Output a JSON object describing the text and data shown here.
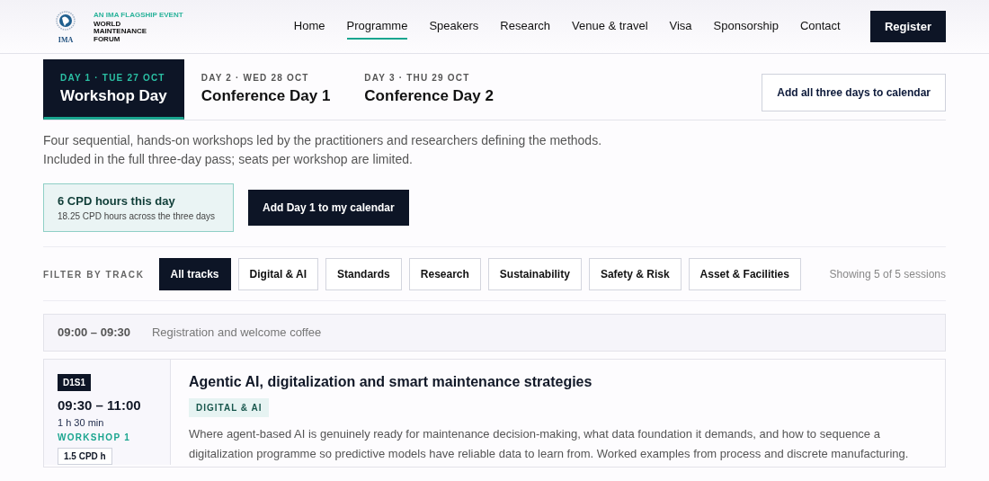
{
  "logo": {
    "tagline": "AN IMA FLAGSHIP EVENT",
    "emblem_text": "IMA",
    "name_lines": [
      "WORLD",
      "MAINTENANCE",
      "FORUM"
    ]
  },
  "nav": [
    {
      "label": "Home",
      "selected": false
    },
    {
      "label": "Programme",
      "selected": true
    },
    {
      "label": "Speakers",
      "selected": false
    },
    {
      "label": "Research",
      "selected": false
    },
    {
      "label": "Venue & travel",
      "selected": false
    },
    {
      "label": "Visa",
      "selected": false
    },
    {
      "label": "Sponsorship",
      "selected": false
    },
    {
      "label": "Contact",
      "selected": false
    }
  ],
  "register_button": "Register",
  "days": [
    {
      "date": "DAY 1 · TUE 27 OCT",
      "title": "Workshop Day",
      "selected": true
    },
    {
      "date": "DAY 2 · WED 28 OCT",
      "title": "Conference Day 1",
      "selected": false
    },
    {
      "date": "DAY 3 · THU 29 OCT",
      "title": "Conference Day 2",
      "selected": false
    }
  ],
  "calendar_all_button": "Add all three days to calendar",
  "intro": [
    "Four sequential, hands-on workshops led by the practitioners and researchers defining the methods.",
    "Included in the full three-day pass; seats per workshop are limited."
  ],
  "cpd": {
    "title": "6 CPD hours this day",
    "subtitle": "18.25 CPD hours across the three days"
  },
  "add_day_button": "Add Day 1 to my calendar",
  "filter": {
    "label": "FILTER BY TRACK",
    "tracks": [
      {
        "label": "All tracks",
        "selected": true
      },
      {
        "label": "Digital & AI",
        "selected": false
      },
      {
        "label": "Standards",
        "selected": false
      },
      {
        "label": "Research",
        "selected": false
      },
      {
        "label": "Sustainability",
        "selected": false
      },
      {
        "label": "Safety & Risk",
        "selected": false
      },
      {
        "label": "Asset & Facilities",
        "selected": false
      }
    ],
    "count": "Showing 5 of 5 sessions"
  },
  "schedule": [
    {
      "kind": "break",
      "time": "09:00 – 09:30",
      "title": "Registration and welcome coffee"
    },
    {
      "kind": "session",
      "code": "D1S1",
      "time": "09:30 – 11:00",
      "duration": "1 h 30 min",
      "workshop": "WORKSHOP 1",
      "cpd": "1.5 CPD h",
      "title": "Agentic AI, digitalization and smart maintenance strategies",
      "track": "DIGITAL & AI",
      "description": "Where agent-based AI is genuinely ready for maintenance decision-making, what data foundation it demands, and how to sequence a digitalization programme so predictive models have reliable data to learn from. Worked examples from process and discrete manufacturing."
    }
  ]
}
